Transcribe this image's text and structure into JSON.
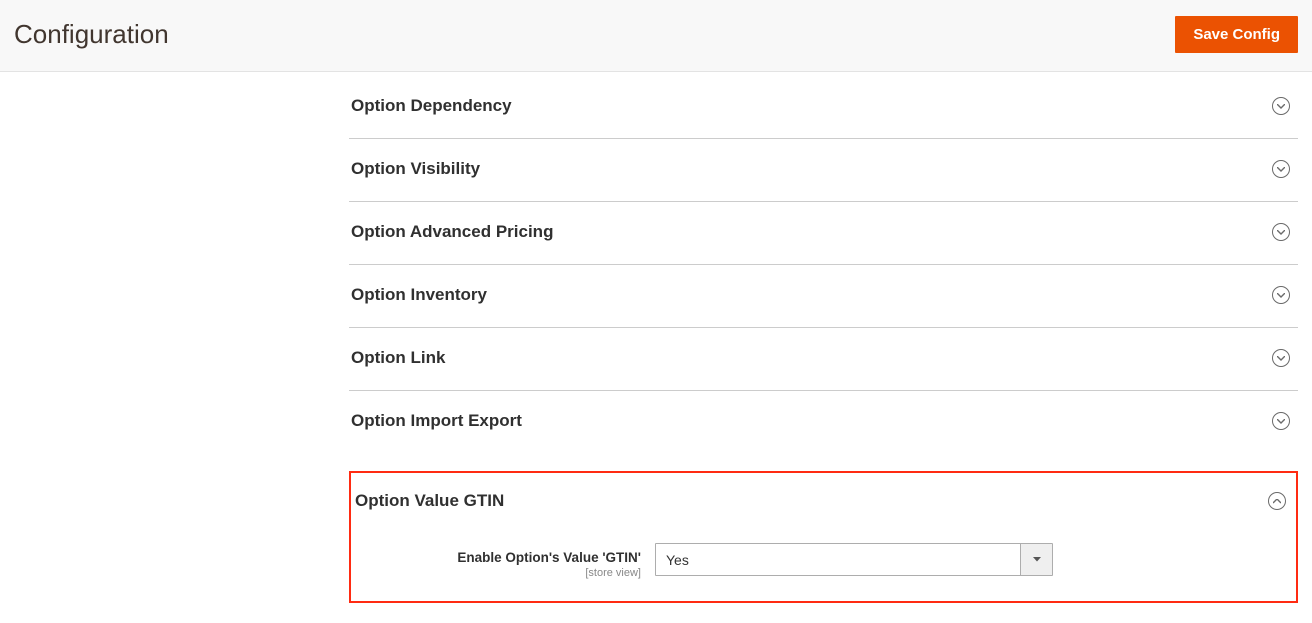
{
  "header": {
    "title": "Configuration",
    "save_label": "Save Config"
  },
  "sections": [
    {
      "title": "Option Dependency"
    },
    {
      "title": "Option Visibility"
    },
    {
      "title": "Option Advanced Pricing"
    },
    {
      "title": "Option Inventory"
    },
    {
      "title": "Option Link"
    },
    {
      "title": "Option Import Export"
    }
  ],
  "highlighted_section": {
    "title": "Option Value GTIN",
    "field": {
      "label": "Enable Option's Value 'GTIN'",
      "scope": "[store view]",
      "value": "Yes"
    }
  }
}
